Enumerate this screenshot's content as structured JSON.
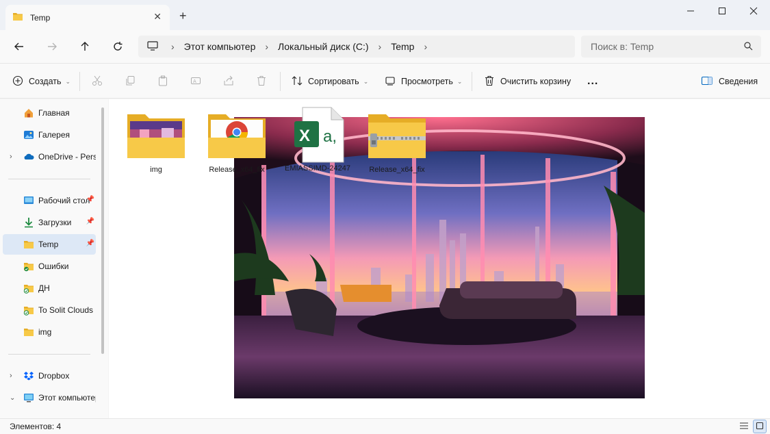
{
  "window": {
    "tab_title": "Temp",
    "new_tab": "+",
    "controls": [
      "minimize-icon",
      "maximize-icon",
      "close-icon"
    ]
  },
  "navigation": {
    "breadcrumbs": [
      "Этот компьютер",
      "Локальный диск (C:)",
      "Temp"
    ],
    "search_placeholder": "Поиск в: Temp"
  },
  "toolbar": {
    "create_label": "Создать",
    "sort_label": "Сортировать",
    "view_label": "Просмотреть",
    "empty_bin_label": "Очистить корзину",
    "more_label": "...",
    "details_label": "Сведения",
    "disabled_icons": [
      "cut-icon",
      "copy-icon",
      "paste-icon",
      "rename-icon",
      "share-icon",
      "delete-icon"
    ]
  },
  "sidebar": {
    "items": [
      {
        "label": "Главная",
        "icon": "home-icon",
        "expandable": false,
        "pinned": false,
        "selected": false
      },
      {
        "label": "Галерея",
        "icon": "gallery-icon",
        "expandable": false,
        "pinned": false,
        "selected": false
      },
      {
        "label": "OneDrive - Personal",
        "icon": "onedrive-icon",
        "expandable": true,
        "pinned": false,
        "selected": false
      },
      {
        "label": "Рабочий стол",
        "icon": "desktop-icon",
        "expandable": false,
        "pinned": true,
        "selected": false
      },
      {
        "label": "Загрузки",
        "icon": "downloads-icon",
        "expandable": false,
        "pinned": true,
        "selected": false
      },
      {
        "label": "Temp",
        "icon": "folder-icon",
        "expandable": false,
        "pinned": true,
        "selected": true
      },
      {
        "label": "Ошибки",
        "icon": "folder-synced-icon",
        "expandable": false,
        "pinned": false,
        "selected": false
      },
      {
        "label": "ДН",
        "icon": "folder-synced-icon",
        "expandable": false,
        "pinned": false,
        "selected": false
      },
      {
        "label": "To Solit Clouds",
        "icon": "folder-synced-icon",
        "expandable": false,
        "pinned": false,
        "selected": false
      },
      {
        "label": "img",
        "icon": "folder-icon",
        "expandable": false,
        "pinned": false,
        "selected": false
      },
      {
        "label": "Dropbox",
        "icon": "dropbox-icon",
        "expandable": true,
        "pinned": false,
        "selected": false
      },
      {
        "label": "Этот компьютер",
        "icon": "computer-icon",
        "expandable": true,
        "pinned": false,
        "selected": false
      }
    ]
  },
  "files": [
    {
      "name": "img",
      "icon": "folder-with-image-thumbnail"
    },
    {
      "name": "Release_x64_fix",
      "icon": "folder-with-chrome-icon"
    },
    {
      "name": "EMIASSIMD-24247",
      "icon": "excel-file-icon"
    },
    {
      "name": "Release_x64_fix",
      "icon": "zip-folder-icon"
    }
  ],
  "status": {
    "items_count": "Элементов: 4"
  },
  "colors": {
    "accent": "#0067c0",
    "folder": "#f7c948",
    "folder_dark": "#e6ad26",
    "excel": "#1f7244",
    "selected_bg": "#dde8f6"
  }
}
